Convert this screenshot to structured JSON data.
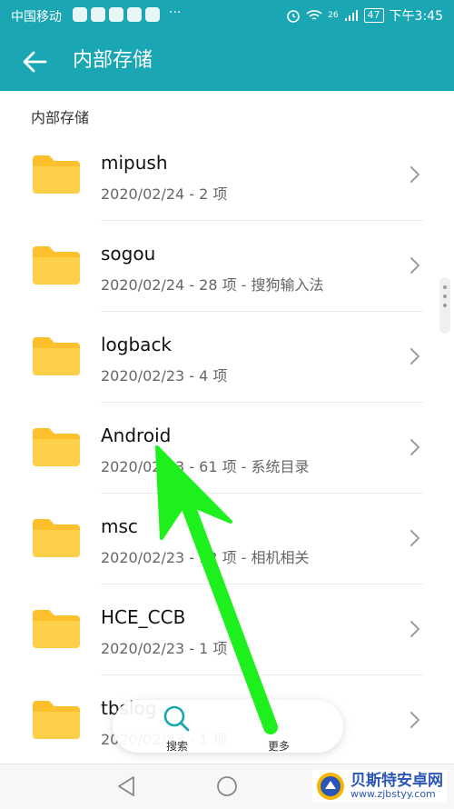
{
  "status_bar": {
    "carrier": "中国移动",
    "dots": "···",
    "signal": "26",
    "battery": "47",
    "time": "下午3:45"
  },
  "app_bar": {
    "title": "内部存储"
  },
  "section_label": "内部存储",
  "folders": [
    {
      "name": "mipush",
      "meta": "2020/02/24 - 2 项"
    },
    {
      "name": "sogou",
      "meta": "2020/02/24 - 28 项 - 搜狗输入法"
    },
    {
      "name": "logback",
      "meta": "2020/02/23 - 4 项"
    },
    {
      "name": "Android",
      "meta": "2020/02/23 - 61 项 - 系统目录"
    },
    {
      "name": "msc",
      "meta": "2020/02/23 - 12 项 - 相机相关"
    },
    {
      "name": "HCE_CCB",
      "meta": "2020/02/23 - 1 项"
    },
    {
      "name": "tbslog",
      "meta": "2020/02/23 - 1 项"
    }
  ],
  "bottom_actions": {
    "search": "搜索",
    "more": "更多"
  },
  "watermark": {
    "title": "贝斯特安卓网",
    "url": "www.zjbstyy.com"
  },
  "colors": {
    "app_bar": "#1ba6b4",
    "folder": "#fcc02c",
    "arrow": "#1ef01e"
  }
}
